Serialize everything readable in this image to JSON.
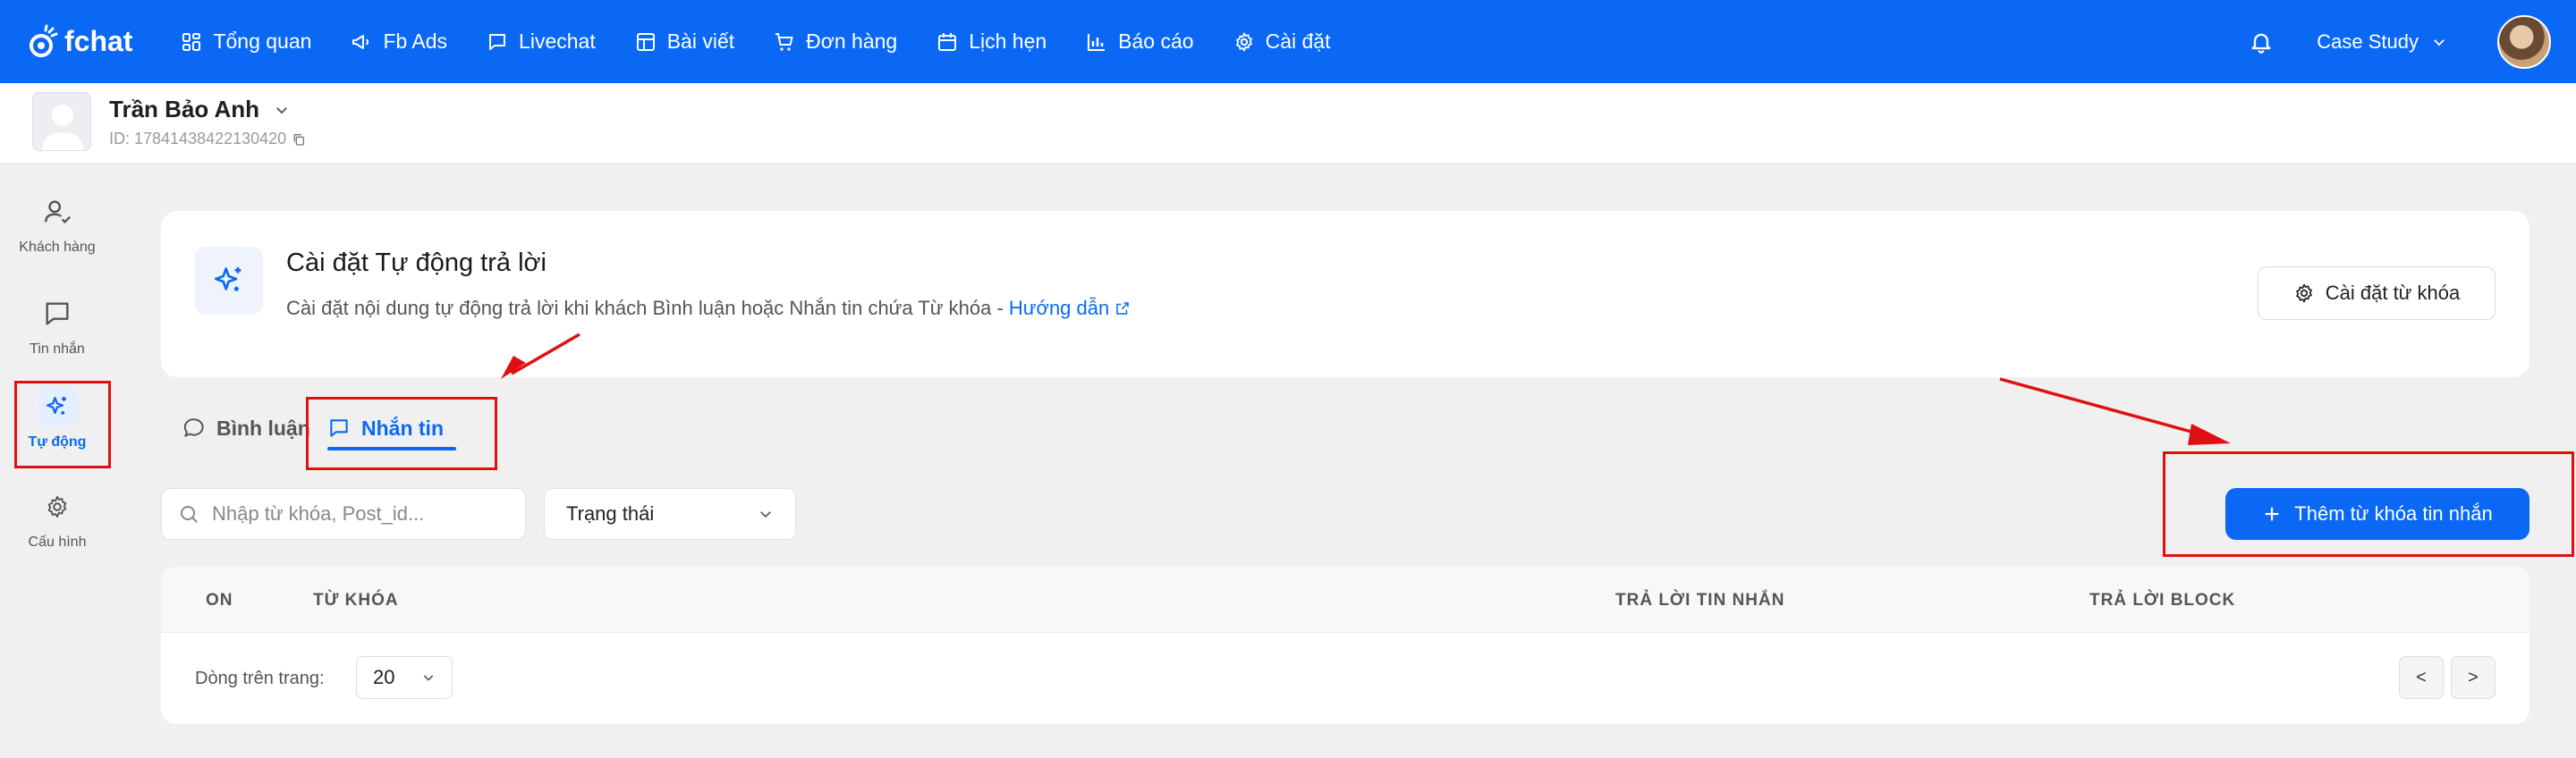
{
  "brand": {
    "name": "fchat"
  },
  "nav": {
    "items": [
      {
        "label": "Tổng quan",
        "icon": "dashboard-icon"
      },
      {
        "label": "Fb Ads",
        "icon": "megaphone-icon"
      },
      {
        "label": "Livechat",
        "icon": "chat-icon"
      },
      {
        "label": "Bài viết",
        "icon": "layout-icon"
      },
      {
        "label": "Đơn hàng",
        "icon": "cart-icon"
      },
      {
        "label": "Lịch hẹn",
        "icon": "calendar-icon"
      },
      {
        "label": "Báo cáo",
        "icon": "bar-chart-icon"
      },
      {
        "label": "Cài đặt",
        "icon": "gear-icon"
      }
    ],
    "workspace": "Case Study"
  },
  "page": {
    "name": "Trần Bảo Anh",
    "id_text": "ID: 17841438422130420"
  },
  "sidebar": {
    "items": [
      {
        "label": "Khách hàng",
        "icon": "user-check-icon"
      },
      {
        "label": "Tin nhắn",
        "icon": "message-icon"
      },
      {
        "label": "Tự động",
        "icon": "sparkle-icon"
      },
      {
        "label": "Cấu hình",
        "icon": "gear-icon"
      }
    ]
  },
  "card": {
    "title": "Cài đặt Tự động trả lời",
    "desc": "Cài đặt nội dung tự động trả lời khi khách Bình luận hoặc Nhắn tin chứa Từ khóa - ",
    "link": "Hướng dẫn",
    "button": "Cài đặt từ khóa"
  },
  "tabs": [
    {
      "label": "Bình luận"
    },
    {
      "label": "Nhắn tin"
    }
  ],
  "filters": {
    "search_placeholder": "Nhập từ khóa, Post_id...",
    "status_label": "Trạng thái",
    "add_button": "Thêm từ khóa tin nhắn"
  },
  "table": {
    "columns": [
      "ON",
      "TỪ KHÓA",
      "TRẢ LỜI TIN NHẮN",
      "TRẢ LỜI BLOCK"
    ],
    "rows_per_page_label": "Dòng trên trang:",
    "rows_per_page": "20",
    "prev": "<",
    "next": ">"
  },
  "colors": {
    "primary": "#0a68f5",
    "annotation": "#e01010"
  }
}
